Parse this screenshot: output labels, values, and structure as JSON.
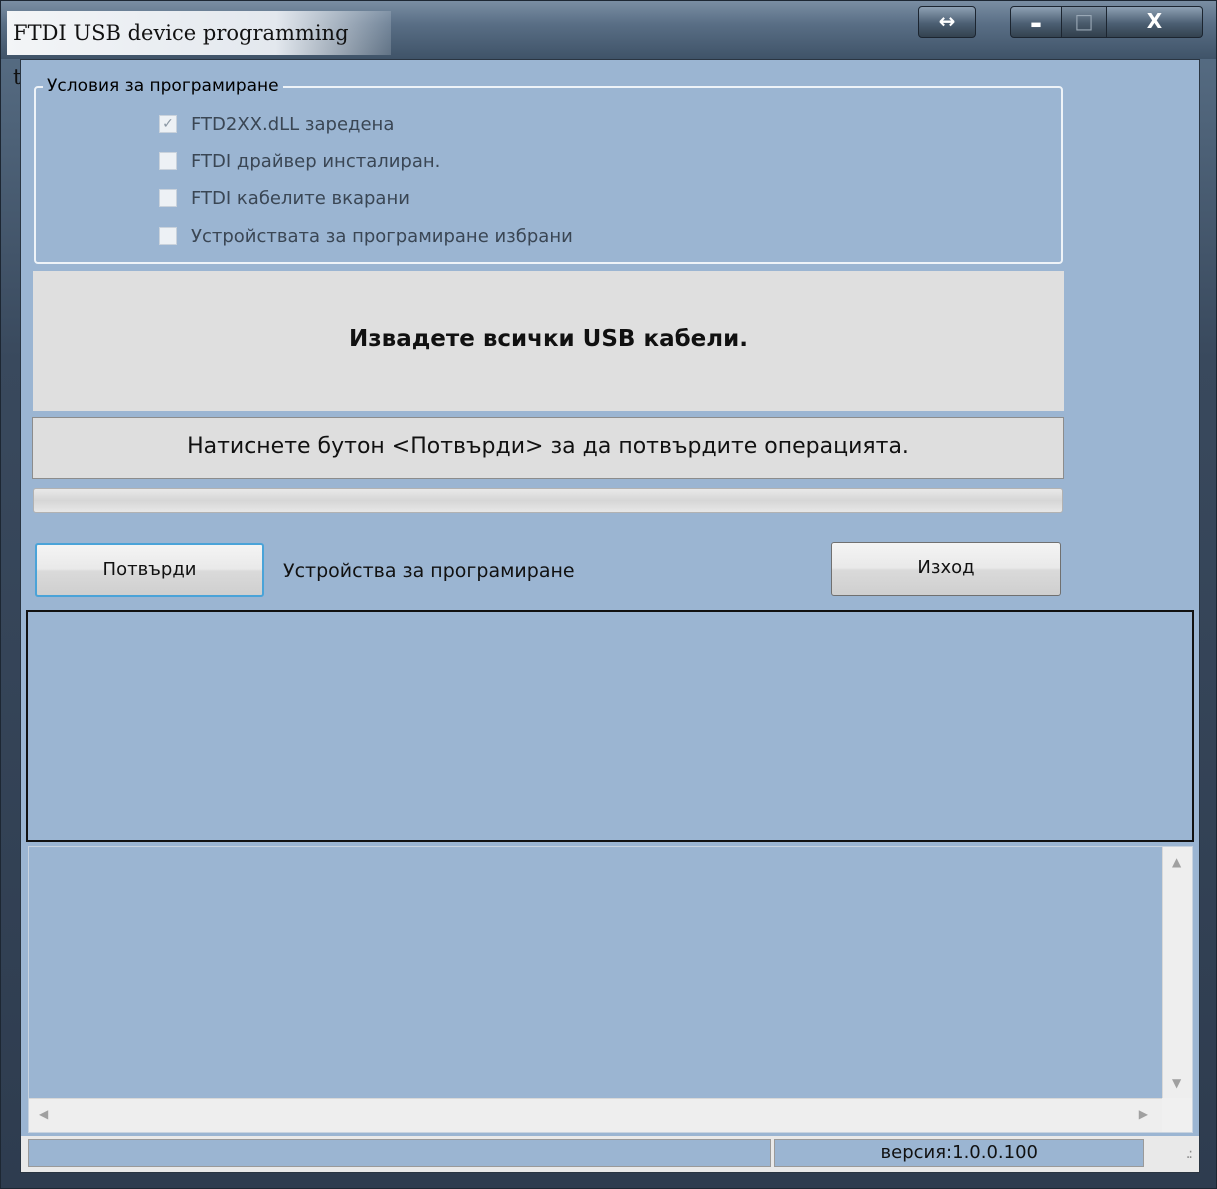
{
  "window": {
    "title": "FTDI USB device programming tool",
    "resize_icon": "↔",
    "minimize_icon": "▬",
    "maximize_icon": "□",
    "close_icon": "X"
  },
  "conditions": {
    "group_label": "Условия за програмиране",
    "items": [
      {
        "label": "FTD2XX.dLL заредена",
        "checked": true
      },
      {
        "label": "FTDI драйвер инсталиран.",
        "checked": false
      },
      {
        "label": "FTDI кабелите вкарани",
        "checked": false
      },
      {
        "label": "Устройствата за програмиране избрани",
        "checked": false
      }
    ]
  },
  "message": "Извадете всички USB кабели.",
  "instruction": "Натиснете бутон <Потвърди> за да потвърдите операцията.",
  "buttons": {
    "confirm": "Потвърди",
    "exit": "Изход"
  },
  "devices_label": "Устройства за програмиране",
  "status": {
    "version": "версия:1.0.0.100"
  },
  "colors": {
    "client_background": "#9bb5d2",
    "panel_gray": "#dfdfdf",
    "focus_border": "#4aa3d8"
  }
}
